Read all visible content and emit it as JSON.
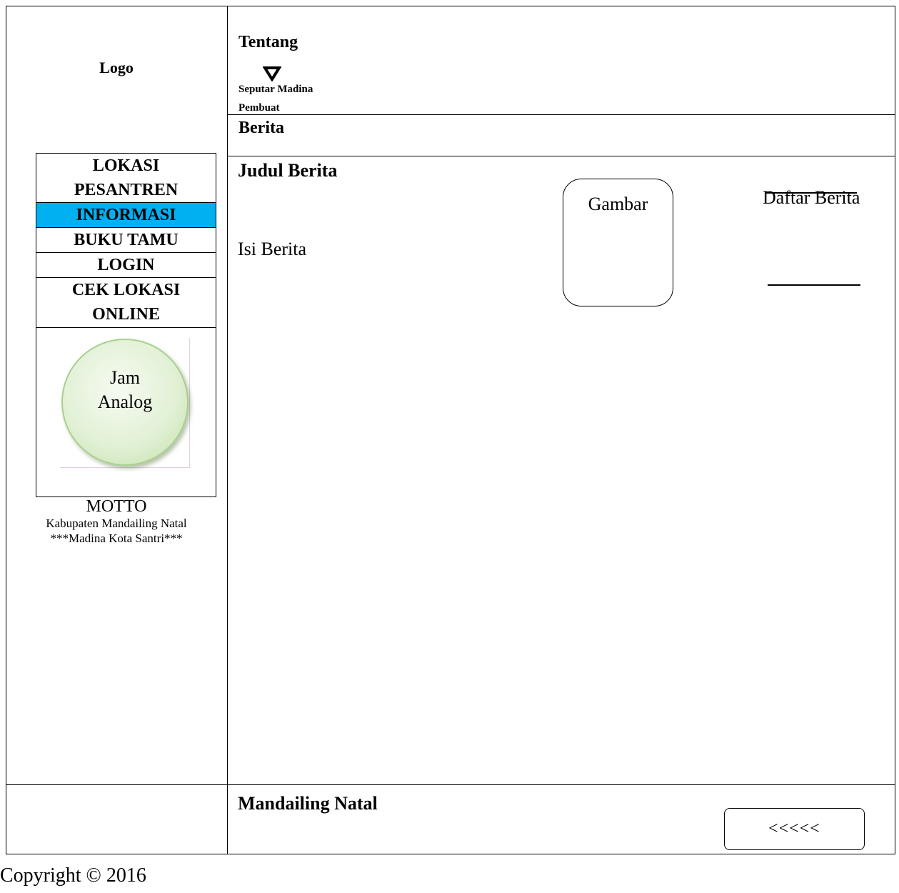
{
  "header": {
    "logo": "Logo",
    "nav_title": "Tentang",
    "dropdown_items": [
      "Seputar Madina",
      "Pembuat"
    ],
    "section_title": "Berita"
  },
  "sidebar": {
    "menu": [
      {
        "label_lines": [
          "LOKASI",
          "PESANTREN"
        ],
        "active": false
      },
      {
        "label_lines": [
          "INFORMASI"
        ],
        "active": true
      },
      {
        "label_lines": [
          "BUKU TAMU"
        ],
        "active": false
      },
      {
        "label_lines": [
          "LOGIN"
        ],
        "active": false
      },
      {
        "label_lines": [
          "CEK LOKASI",
          "ONLINE"
        ],
        "active": false
      }
    ],
    "clock_lines": [
      "Jam",
      "Analog"
    ],
    "motto": {
      "title": "MOTTO",
      "line1": "Kabupaten Mandailing Natal",
      "line2": "***Madina Kota Santri***"
    }
  },
  "main": {
    "judul": "Judul Berita",
    "isi": "Isi Berita",
    "gambar": "Gambar",
    "daftar": "Daftar Berita"
  },
  "footer": {
    "title": "Mandailing Natal",
    "back_button": "<<<<<",
    "copyright": "Copyright © 2016"
  },
  "colors": {
    "active_menu": "#00b0f0",
    "clock_fill": "#e2f1d6",
    "clock_border": "#a8d08d"
  },
  "icons": {
    "dropdown": "triangle-down-icon"
  }
}
